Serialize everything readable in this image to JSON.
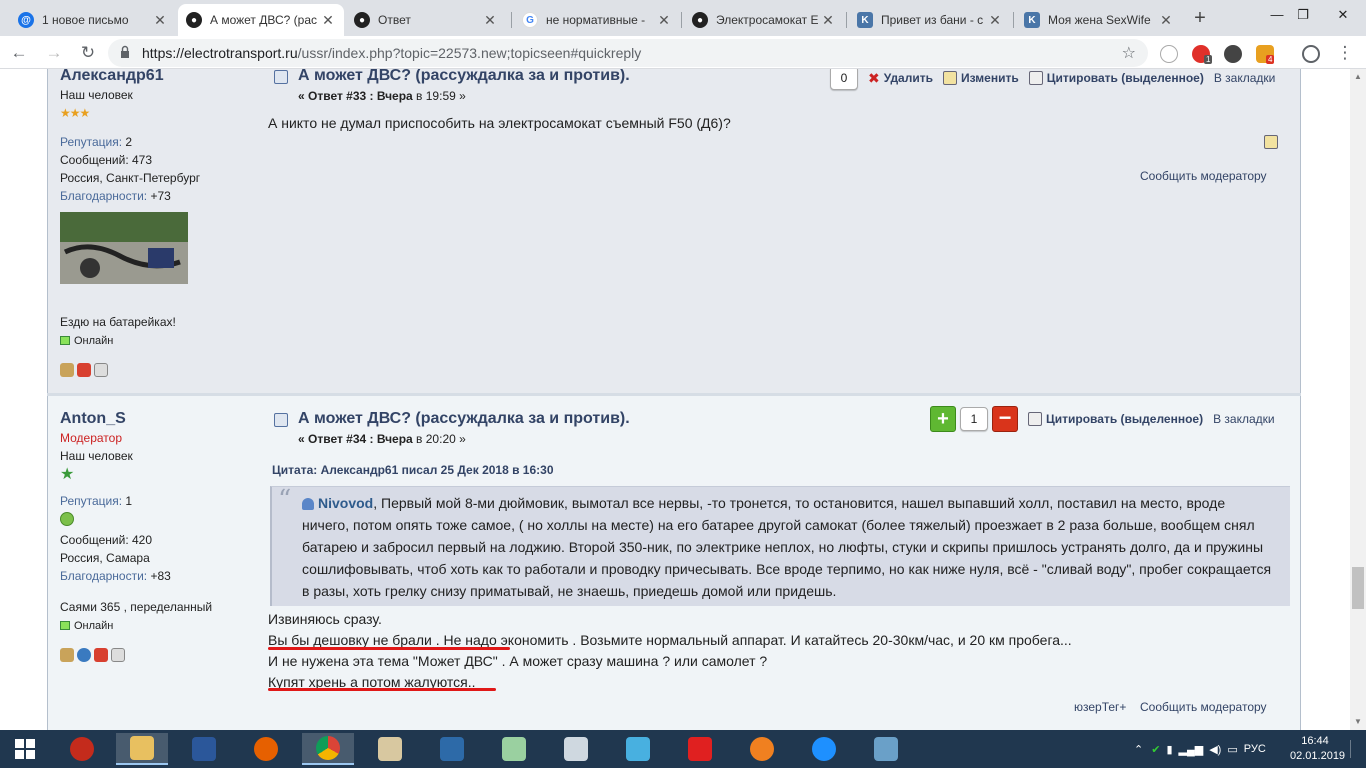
{
  "browser": {
    "tabs": [
      {
        "title": "1 новое письмо",
        "icon": "mail-icon",
        "color": "#1a73e8"
      },
      {
        "title": "А может ДВС? (рас",
        "icon": "forum-icon",
        "color": "#222222",
        "active": true
      },
      {
        "title": "Ответ",
        "icon": "forum-icon",
        "color": "#222222"
      },
      {
        "title": "не нормативные -",
        "icon": "google-icon",
        "color": "#4285f4"
      },
      {
        "title": "Электросамокат Е",
        "icon": "forum-icon",
        "color": "#222222"
      },
      {
        "title": "Привет из бани - с",
        "icon": "vk-icon",
        "color": "#4a76a8"
      },
      {
        "title": "Моя жена SexWife",
        "icon": "vk-icon",
        "color": "#4a76a8"
      }
    ],
    "url_host": "https://electrotransport.ru",
    "url_path": "/ussr/index.php?topic=22573.new;topicseen#quickreply",
    "ext_badge_1": "1",
    "ext_badge_2": "4"
  },
  "post1": {
    "author": "Александр61",
    "title_line": "Наш человек",
    "rep_label": "Репутация:",
    "rep_value": " 2",
    "msgs": "Сообщений: 473",
    "location": "Россия, Санкт-Петербург",
    "thanks_label": "Благодарности:",
    "thanks_value": " +73",
    "signature": "Ездю на батарейках!",
    "online": "Онлайн",
    "subject": "А может ДВС? (рассуждалка за и против).",
    "reply_label": "« Ответ #33 : ",
    "date_bold": "Вчера",
    "date_rest": " в 19:59 »",
    "counter": "0",
    "delete": "Удалить",
    "edit": "Изменить",
    "quote": "Цитировать (выделенное)",
    "bookmark": "В закладки",
    "body": "А никто не думал приспособить на электросамокат съемный F50 (Д6)?",
    "report": "Сообщить модератору"
  },
  "post2": {
    "author": "Anton_S",
    "role": "Модератор",
    "title_line": "Наш человек",
    "rep_label": "Репутация:",
    "rep_value": " 1",
    "msgs": "Сообщений: 420",
    "location": "Россия, Самара",
    "thanks_label": "Благодарности:",
    "thanks_value": " +83",
    "signature": "Саями 365 , переделанный",
    "online": "Онлайн",
    "subject": "А может ДВС? (рассуждалка за и против).",
    "reply_label": "« Ответ #34 : ",
    "date_bold": "Вчера",
    "date_rest": " в 20:20 »",
    "plus": "+",
    "counter": "1",
    "minus": "−",
    "quote": "Цитировать (выделенное)",
    "bookmark": "В закладки",
    "quote_header": "Цитата: Александр61 писал 25 Дек 2018 в 16:30",
    "quote_author": "Nivovod",
    "quote_text": ", Первый мой 8-ми дюймовик, вымотал все нервы, -то тронется, то остановится, нашел выпавший холл, поставил на место, вроде ничего, потом опять тоже самое, ( но холлы на месте) на его батарее другой самокат (более тяжелый) проезжает в 2 раза больше, вообщем снял батарею и забросил первый на лоджию. Второй 350-ник, по электрике неплох, но люфты, стуки и скрипы пришлось устранять долго, да и пружины сошлифовывать, чтоб хоть как то работали и проводку причесывать. Все вроде терпимо, но как ниже нуля, всё - \"сливай воду\", пробег сокращается в разы, хоть грелку снизу приматывай, не знаешь, приедешь домой или придешь.",
    "body_lines": [
      "Извиняюсь сразу.",
      "Вы бы  дешовку не брали . Не надо экономить . Возьмите нормальный аппарат. И катайтесь 20-30км/час, и 20 км пробега...",
      "И не нужена эта тема \"Может ДВС\" .   А может сразу машина ? или самолет ?",
      "Купят хрень а потом жалуются.."
    ],
    "usertag": "юзерТег+",
    "report": "Сообщить модератору"
  },
  "taskbar": {
    "lang": "РУС",
    "time": "16:44",
    "date": "02.01.2019"
  },
  "colors": {
    "accent_red": "#e01818",
    "link_blue": "#334466",
    "moderator_red": "#cc2222"
  }
}
